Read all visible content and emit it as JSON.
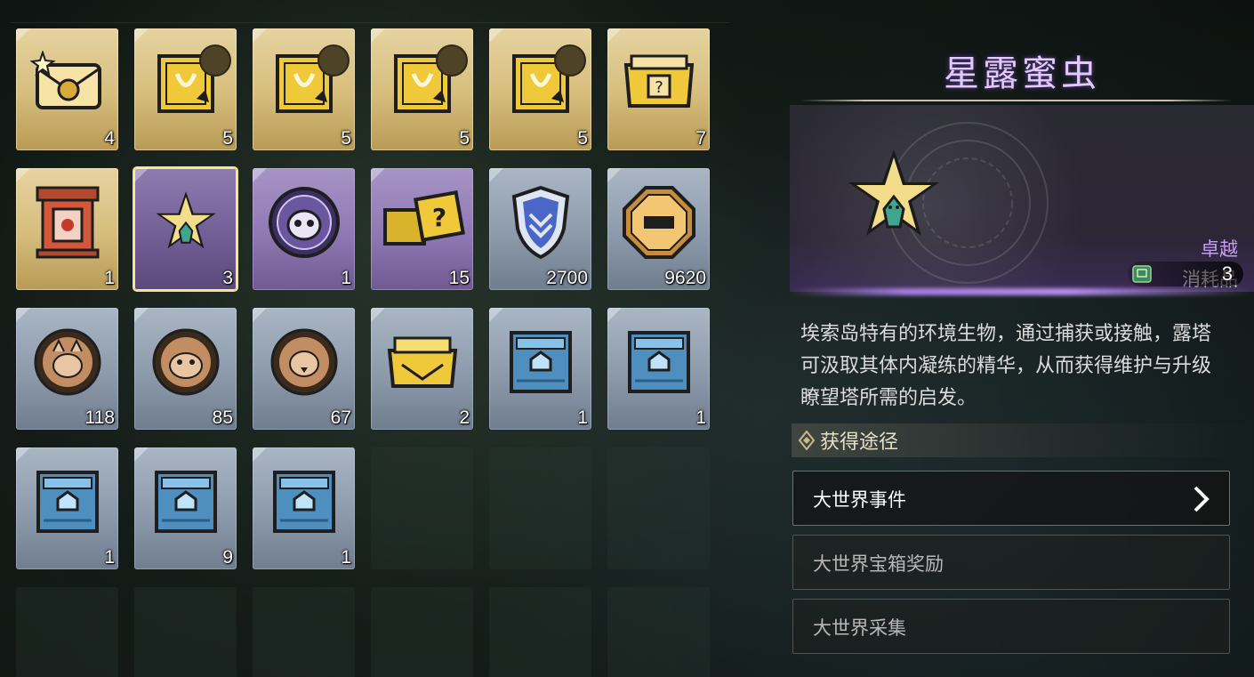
{
  "inventory": {
    "rows": [
      [
        {
          "name": "letter-item",
          "rarity": "gold",
          "count": "4",
          "icon": "sealed-letter-icon"
        },
        {
          "name": "manual-item-1",
          "rarity": "gold",
          "count": "5",
          "icon": "weapon-manual-icon"
        },
        {
          "name": "manual-item-2",
          "rarity": "gold",
          "count": "5",
          "icon": "weapon-manual-icon"
        },
        {
          "name": "manual-item-3",
          "rarity": "gold",
          "count": "5",
          "icon": "weapon-manual-icon"
        },
        {
          "name": "manual-item-4",
          "rarity": "gold",
          "count": "5",
          "icon": "weapon-manual-icon"
        },
        {
          "name": "mystery-chest-gold",
          "rarity": "gold",
          "count": "7",
          "icon": "mystery-chest-icon"
        }
      ],
      [
        {
          "name": "stall-item",
          "rarity": "gold",
          "count": "1",
          "icon": "stall-icon"
        },
        {
          "name": "star-dew-bug",
          "rarity": "purple",
          "count": "3",
          "icon": "star-bug-icon",
          "selected": true
        },
        {
          "name": "owl-medal",
          "rarity": "purple",
          "count": "1",
          "icon": "owl-medal-icon"
        },
        {
          "name": "mystery-crate",
          "rarity": "purple",
          "count": "15",
          "icon": "mystery-crate-icon"
        },
        {
          "name": "shield-crest",
          "rarity": "blue",
          "count": "2700",
          "icon": "shield-icon"
        },
        {
          "name": "coin-octagon",
          "rarity": "blue",
          "count": "9620",
          "icon": "coin-icon"
        }
      ],
      [
        {
          "name": "cat-medal",
          "rarity": "blue",
          "count": "118",
          "icon": "cat-medal-icon"
        },
        {
          "name": "monkey-medal",
          "rarity": "blue",
          "count": "85",
          "icon": "monkey-medal-icon"
        },
        {
          "name": "bird-medal",
          "rarity": "blue",
          "count": "67",
          "icon": "bird-medal-icon"
        },
        {
          "name": "gold-chest",
          "rarity": "blue",
          "count": "2",
          "icon": "gold-chest-icon"
        },
        {
          "name": "blue-chest-1",
          "rarity": "blue",
          "count": "1",
          "icon": "blue-chest-icon"
        },
        {
          "name": "blue-chest-2",
          "rarity": "blue",
          "count": "1",
          "icon": "blue-chest-icon"
        }
      ],
      [
        {
          "name": "blue-chest-3",
          "rarity": "blue",
          "count": "1",
          "icon": "blue-chest-icon"
        },
        {
          "name": "blue-chest-4",
          "rarity": "blue",
          "count": "9",
          "icon": "blue-chest-icon"
        },
        {
          "name": "blue-chest-5",
          "rarity": "blue",
          "count": "1",
          "icon": "blue-chest-icon"
        },
        null,
        null,
        null
      ],
      [
        null,
        null,
        null,
        null,
        null,
        null
      ]
    ]
  },
  "detail": {
    "title": "星露蜜虫",
    "rarity": "卓越",
    "type": "消耗品",
    "owned_count": "3",
    "description": "埃索岛特有的环境生物，通过捕获或接触，露塔可汲取其体内凝练的精华，从而获得维护与升级瞭望塔所需的启发。",
    "source_title": "获得途径",
    "sources": [
      {
        "label": "大世界事件",
        "active": true
      },
      {
        "label": "大世界宝箱奖励",
        "active": false
      },
      {
        "label": "大世界采集",
        "active": false
      }
    ]
  },
  "colors": {
    "title": "#e2c9ff",
    "rarity_purple": "#c69df0",
    "selected_border": "#f2e58a"
  }
}
